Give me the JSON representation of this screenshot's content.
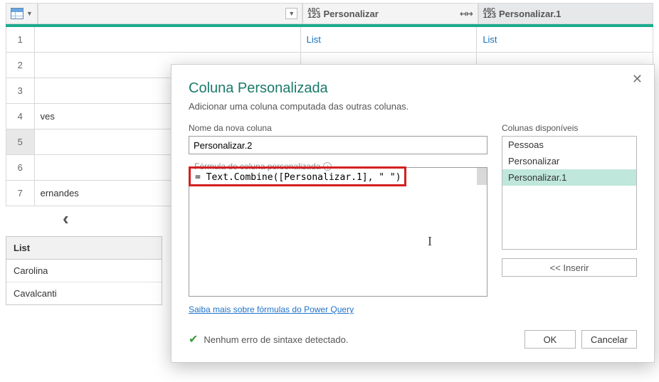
{
  "grid": {
    "typeLabel": "ABC\n123",
    "col_personalizar": "Personalizar",
    "col_personalizar1": "Personalizar.1",
    "rows": [
      {
        "n": "1",
        "c1": "",
        "c2": "List",
        "c3": "List"
      },
      {
        "n": "2",
        "c1": "",
        "c2": "",
        "c3": ""
      },
      {
        "n": "3",
        "c1": "",
        "c2": "",
        "c3": ""
      },
      {
        "n": "4",
        "c1": "ves",
        "c2": "",
        "c3": ""
      },
      {
        "n": "5",
        "c1": "",
        "c2": "",
        "c3": ""
      },
      {
        "n": "6",
        "c1": "",
        "c2": "",
        "c3": ""
      },
      {
        "n": "7",
        "c1": "ernandes",
        "c2": "",
        "c3": ""
      }
    ]
  },
  "miniList": {
    "header": "List",
    "items": [
      "Carolina",
      "Cavalcanti"
    ]
  },
  "dialog": {
    "title": "Coluna Personalizada",
    "subtitle": "Adicionar uma coluna computada das outras colunas.",
    "newColLabel": "Nome da nova coluna",
    "newColValue": "Personalizar.2",
    "formulaLabel": "Fórmula de coluna personalizada",
    "formulaValue": "= Text.Combine([Personalizar.1], \" \")",
    "availLabel": "Colunas disponíveis",
    "availCols": [
      "Pessoas",
      "Personalizar",
      "Personalizar.1"
    ],
    "insertLabel": "<< Inserir",
    "learnMore": "Saiba mais sobre fórmulas do Power Query",
    "statusMsg": "Nenhum erro de sintaxe detectado.",
    "okLabel": "OK",
    "cancelLabel": "Cancelar"
  }
}
